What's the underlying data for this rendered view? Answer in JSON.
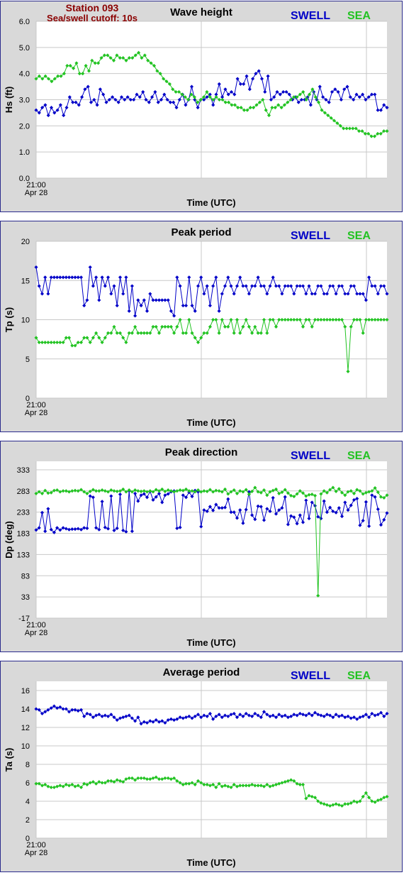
{
  "station": {
    "title": "Station 093",
    "cutoff": "Sea/swell cutoff: 10s"
  },
  "legend": {
    "swell": "SWELL",
    "sea": "SEA"
  },
  "colors": {
    "swell": "#0000c8",
    "sea": "#22c322",
    "grid": "#c8c8c8",
    "panel_bg": "#d9d9d9",
    "plot_bg": "#ffffff",
    "border": "#2b2b8c",
    "station_title": "#8b0000"
  },
  "x_axis": {
    "start_time": "21:00",
    "start_date": "Apr 28",
    "label": "Time (UTC)"
  },
  "chart_data": [
    {
      "type": "line",
      "title": "Wave height",
      "ylabel": "Hs (ft)",
      "ylim": [
        0,
        6
      ],
      "yticks": [
        "0.0",
        "1.0",
        "2.0",
        "3.0",
        "4.0",
        "5.0",
        "6.0"
      ],
      "ytick_values": [
        0,
        1,
        2,
        3,
        4,
        5,
        6
      ],
      "grid": true,
      "legend": "top-right",
      "series": [
        {
          "name": "SWELL",
          "values": [
            2.6,
            2.5,
            2.7,
            2.8,
            2.4,
            2.7,
            2.5,
            2.6,
            2.8,
            2.4,
            2.7,
            3.1,
            2.9,
            2.9,
            2.8,
            3.1,
            3.4,
            3.5,
            2.9,
            3.0,
            2.8,
            3.4,
            3.2,
            2.9,
            3.0,
            3.1,
            3.0,
            2.9,
            3.1,
            3.0,
            3.1,
            3.0,
            3.0,
            3.2,
            3.1,
            3.3,
            3.0,
            2.9,
            3.1,
            3.3,
            2.9,
            3.0,
            3.2,
            3.0,
            2.9,
            2.9,
            2.7,
            3.0,
            3.2,
            2.8,
            3.0,
            3.5,
            3.0,
            2.7,
            3.0,
            3.0,
            3.1,
            3.2,
            2.8,
            3.2,
            3.6,
            3.1,
            3.4,
            3.2,
            3.3,
            3.2,
            3.8,
            3.6,
            3.6,
            3.9,
            3.4,
            3.8,
            4.0,
            4.1,
            3.8,
            3.3,
            3.9,
            3.0,
            3.1,
            3.3,
            3.2,
            3.3,
            3.3,
            3.2,
            3.0,
            3.1,
            2.9,
            3.0,
            3.0,
            3.1,
            2.8,
            3.3,
            3.0,
            3.5,
            3.1,
            3.0,
            2.9,
            3.3,
            3.4,
            3.3,
            3.0,
            3.4,
            3.5,
            3.1,
            3.0,
            3.2,
            3.1,
            3.2,
            3.0,
            3.1,
            3.2,
            3.2,
            2.6,
            2.6,
            2.8,
            2.7
          ]
        },
        {
          "name": "SEA",
          "values": [
            3.8,
            3.9,
            3.8,
            3.9,
            3.8,
            3.7,
            3.8,
            3.9,
            3.9,
            4.0,
            4.3,
            4.3,
            4.2,
            4.4,
            4.0,
            4.0,
            4.3,
            4.1,
            4.5,
            4.4,
            4.4,
            4.6,
            4.7,
            4.7,
            4.6,
            4.5,
            4.7,
            4.6,
            4.6,
            4.5,
            4.6,
            4.6,
            4.7,
            4.8,
            4.6,
            4.7,
            4.5,
            4.4,
            4.3,
            4.1,
            4.0,
            3.8,
            3.7,
            3.6,
            3.4,
            3.3,
            3.3,
            3.2,
            3.1,
            3.0,
            3.2,
            3.1,
            2.9,
            3.0,
            3.1,
            3.3,
            3.1,
            3.0,
            3.1,
            3.0,
            3.0,
            2.9,
            2.9,
            2.8,
            2.8,
            2.7,
            2.7,
            2.6,
            2.6,
            2.7,
            2.7,
            2.8,
            2.9,
            3.0,
            2.6,
            2.4,
            2.7,
            2.7,
            2.8,
            2.7,
            2.8,
            2.9,
            3.0,
            3.1,
            3.1,
            3.2,
            3.3,
            3.0,
            3.2,
            3.4,
            3.1,
            2.9,
            2.6,
            2.5,
            2.4,
            2.3,
            2.2,
            2.1,
            2.0,
            1.9,
            1.9,
            1.9,
            1.9,
            1.9,
            1.8,
            1.8,
            1.7,
            1.7,
            1.6,
            1.6,
            1.7,
            1.7,
            1.8,
            1.8
          ]
        }
      ]
    },
    {
      "type": "line",
      "title": "Peak period",
      "ylabel": "Tp (s)",
      "ylim": [
        0,
        20
      ],
      "yticks": [
        "0",
        "5",
        "10",
        "15",
        "20"
      ],
      "ytick_values": [
        0,
        5,
        10,
        15,
        20
      ],
      "grid": true,
      "legend": "top-right",
      "series": [
        {
          "name": "SWELL",
          "values": [
            16.7,
            14.3,
            13.3,
            15.4,
            13.3,
            15.4,
            15.4,
            15.4,
            15.4,
            15.4,
            15.4,
            15.4,
            15.4,
            15.4,
            15.4,
            15.4,
            11.8,
            12.5,
            16.7,
            14.3,
            15.4,
            12.5,
            15.4,
            14.3,
            15.4,
            13.3,
            14.3,
            11.8,
            15.4,
            13.3,
            15.4,
            11.1,
            14.3,
            10.5,
            12.5,
            11.8,
            12.5,
            11.1,
            13.3,
            12.5,
            12.5,
            12.5,
            12.5,
            12.5,
            12.5,
            11.1,
            10.5,
            15.4,
            14.3,
            11.8,
            11.8,
            15.4,
            11.8,
            11.1,
            14.3,
            15.4,
            13.3,
            14.3,
            11.8,
            14.3,
            15.4,
            11.1,
            13.3,
            14.3,
            15.4,
            14.3,
            13.3,
            14.3,
            15.4,
            14.3,
            14.3,
            13.3,
            14.3,
            14.3,
            15.4,
            14.3,
            14.3,
            13.3,
            14.3,
            15.4,
            14.3,
            14.3,
            13.3,
            14.3,
            14.3,
            14.3,
            13.3,
            14.3,
            14.3,
            14.3,
            13.3,
            14.3,
            13.3,
            13.3,
            14.3,
            14.3,
            13.3,
            13.3,
            14.3,
            14.3,
            13.3,
            14.3,
            14.3,
            13.3,
            13.3,
            14.3,
            14.3,
            13.3,
            13.3,
            13.3,
            12.5,
            15.4,
            14.3,
            14.3,
            13.3,
            14.3,
            14.3,
            13.3
          ]
        },
        {
          "name": "SEA",
          "values": [
            7.7,
            7.1,
            7.1,
            7.1,
            7.1,
            7.1,
            7.1,
            7.1,
            7.1,
            7.1,
            7.7,
            7.7,
            6.7,
            6.7,
            7.1,
            7.1,
            7.7,
            7.7,
            7.1,
            7.7,
            8.3,
            7.7,
            7.1,
            7.7,
            8.3,
            8.3,
            9.1,
            8.3,
            8.3,
            7.7,
            7.1,
            8.3,
            8.3,
            9.1,
            8.3,
            8.3,
            8.3,
            8.3,
            8.3,
            9.1,
            9.1,
            8.3,
            9.1,
            9.1,
            9.1,
            9.1,
            8.3,
            9.1,
            10.0,
            8.3,
            8.3,
            10.0,
            8.3,
            7.7,
            7.1,
            7.7,
            8.3,
            8.3,
            9.1,
            10.0,
            10.0,
            8.3,
            10.0,
            9.1,
            9.1,
            10.0,
            8.3,
            10.0,
            8.3,
            9.1,
            10.0,
            9.1,
            8.3,
            9.1,
            8.3,
            8.3,
            10.0,
            8.3,
            10.0,
            10.0,
            9.1,
            10.0,
            10.0,
            10.0,
            10.0,
            10.0,
            10.0,
            10.0,
            10.0,
            9.1,
            10.0,
            10.0,
            9.1,
            10.0,
            10.0,
            10.0,
            10.0,
            10.0,
            10.0,
            10.0,
            10.0,
            10.0,
            10.0,
            9.1,
            3.4,
            9.1,
            10.0,
            10.0,
            10.0,
            8.3,
            10.0,
            10.0,
            10.0,
            10.0,
            10.0,
            10.0,
            10.0,
            10.0
          ]
        }
      ]
    },
    {
      "type": "line",
      "title": "Peak direction",
      "ylabel": "Dp (deg)",
      "ylim": [
        -17,
        353
      ],
      "yticks": [
        "-17",
        "33",
        "83",
        "133",
        "183",
        "233",
        "283",
        "333"
      ],
      "ytick_values": [
        -17,
        33,
        83,
        133,
        183,
        233,
        283,
        333
      ],
      "grid": true,
      "legend": "top-right",
      "series": [
        {
          "name": "SWELL",
          "values": [
            191,
            196,
            232,
            188,
            241,
            192,
            185,
            196,
            191,
            196,
            194,
            192,
            193,
            193,
            194,
            192,
            196,
            195,
            271,
            268,
            196,
            192,
            258,
            197,
            194,
            271,
            190,
            195,
            275,
            190,
            187,
            283,
            188,
            277,
            259,
            273,
            276,
            268,
            282,
            262,
            269,
            277,
            256,
            273,
            276,
            281,
            283,
            195,
            197,
            273,
            268,
            280,
            270,
            284,
            281,
            199,
            238,
            235,
            246,
            237,
            251,
            243,
            243,
            244,
            264,
            233,
            233,
            219,
            238,
            207,
            239,
            281,
            226,
            216,
            247,
            246,
            214,
            241,
            235,
            267,
            229,
            238,
            243,
            269,
            204,
            224,
            221,
            206,
            226,
            209,
            261,
            218,
            256,
            248,
            222,
            218,
            259,
            233,
            244,
            235,
            232,
            243,
            223,
            256,
            238,
            249,
            262,
            265,
            202,
            213,
            257,
            200,
            273,
            269,
            240,
            203,
            215,
            231
          ]
        },
        {
          "name": "SEA",
          "values": [
            277,
            281,
            277,
            284,
            278,
            279,
            284,
            285,
            281,
            283,
            283,
            281,
            283,
            284,
            283,
            286,
            281,
            277,
            282,
            286,
            283,
            283,
            285,
            283,
            281,
            285,
            283,
            282,
            283,
            287,
            281,
            285,
            281,
            285,
            283,
            282,
            283,
            281,
            283,
            281,
            286,
            283,
            287,
            282,
            285,
            283,
            281,
            283,
            285,
            284,
            287,
            283,
            283,
            281,
            285,
            281,
            283,
            282,
            286,
            281,
            284,
            283,
            281,
            287,
            276,
            281,
            285,
            277,
            283,
            281,
            286,
            275,
            282,
            291,
            281,
            279,
            285,
            273,
            281,
            284,
            287,
            277,
            280,
            286,
            278,
            272,
            270,
            276,
            283,
            278,
            271,
            274,
            275,
            272,
            36,
            276,
            283,
            279,
            286,
            291,
            282,
            288,
            279,
            273,
            281,
            283,
            277,
            286,
            283,
            276,
            279,
            281,
            283,
            290,
            280,
            269,
            267,
            273
          ]
        }
      ]
    },
    {
      "type": "line",
      "title": "Average period",
      "ylabel": "Ta (s)",
      "ylim": [
        0,
        17
      ],
      "yticks": [
        "0",
        "2",
        "4",
        "6",
        "8",
        "10",
        "12",
        "14",
        "16"
      ],
      "ytick_values": [
        0,
        2,
        4,
        6,
        8,
        10,
        12,
        14,
        16
      ],
      "grid": true,
      "legend": "top-right",
      "series": [
        {
          "name": "SWELL",
          "values": [
            14.0,
            13.9,
            13.5,
            13.7,
            13.9,
            14.1,
            14.3,
            14.1,
            14.2,
            14.0,
            14.0,
            13.7,
            13.9,
            13.9,
            13.8,
            13.9,
            13.2,
            13.5,
            13.4,
            13.1,
            13.3,
            13.4,
            13.2,
            13.3,
            13.2,
            13.4,
            13.1,
            12.8,
            13.0,
            13.1,
            13.2,
            13.3,
            13.0,
            12.7,
            13.1,
            12.4,
            12.6,
            12.5,
            12.7,
            12.6,
            12.8,
            12.6,
            12.7,
            12.5,
            12.8,
            12.9,
            12.8,
            12.9,
            13.1,
            13.0,
            13.1,
            13.2,
            13.0,
            13.2,
            13.4,
            13.1,
            13.3,
            13.2,
            13.5,
            12.9,
            13.2,
            13.4,
            13.1,
            13.3,
            13.2,
            13.4,
            13.5,
            13.1,
            13.4,
            13.2,
            13.5,
            13.3,
            13.2,
            13.5,
            13.3,
            13.1,
            13.7,
            13.4,
            13.2,
            13.3,
            13.1,
            13.4,
            13.2,
            13.3,
            13.1,
            13.2,
            13.4,
            13.3,
            13.5,
            13.4,
            13.3,
            13.5,
            13.3,
            13.6,
            13.4,
            13.3,
            13.2,
            13.4,
            13.3,
            13.1,
            13.4,
            13.2,
            13.3,
            13.1,
            13.2,
            13.0,
            13.1,
            12.9,
            13.1,
            13.2,
            13.4,
            13.1,
            13.5,
            13.3,
            13.4,
            13.6,
            13.2,
            13.5
          ]
        },
        {
          "name": "SEA",
          "values": [
            5.9,
            5.9,
            5.7,
            5.8,
            5.6,
            5.5,
            5.5,
            5.6,
            5.7,
            5.6,
            5.8,
            5.7,
            5.8,
            5.6,
            5.7,
            5.5,
            5.9,
            5.8,
            6.0,
            6.1,
            5.9,
            6.1,
            6.0,
            6.0,
            6.2,
            6.2,
            6.1,
            6.3,
            6.2,
            6.1,
            6.4,
            6.5,
            6.5,
            6.3,
            6.5,
            6.5,
            6.5,
            6.4,
            6.4,
            6.5,
            6.6,
            6.4,
            6.4,
            6.5,
            6.5,
            6.4,
            6.5,
            6.2,
            6.0,
            5.8,
            5.9,
            5.9,
            6.0,
            5.8,
            6.2,
            6.0,
            5.8,
            5.8,
            5.7,
            5.8,
            5.5,
            5.9,
            5.6,
            5.7,
            5.6,
            5.5,
            5.8,
            5.6,
            5.7,
            5.7,
            5.7,
            5.7,
            5.8,
            5.7,
            5.7,
            5.7,
            5.6,
            5.8,
            5.6,
            5.7,
            5.8,
            5.9,
            6.0,
            6.1,
            6.2,
            6.3,
            6.2,
            5.9,
            5.8,
            5.8,
            4.3,
            4.6,
            4.5,
            4.4,
            4.0,
            3.8,
            3.7,
            3.6,
            3.5,
            3.6,
            3.7,
            3.6,
            3.5,
            3.7,
            3.7,
            3.8,
            4.0,
            3.9,
            4.0,
            4.5,
            4.9,
            4.4,
            4.0,
            3.9,
            4.1,
            4.2,
            4.4,
            4.5
          ]
        }
      ]
    }
  ]
}
